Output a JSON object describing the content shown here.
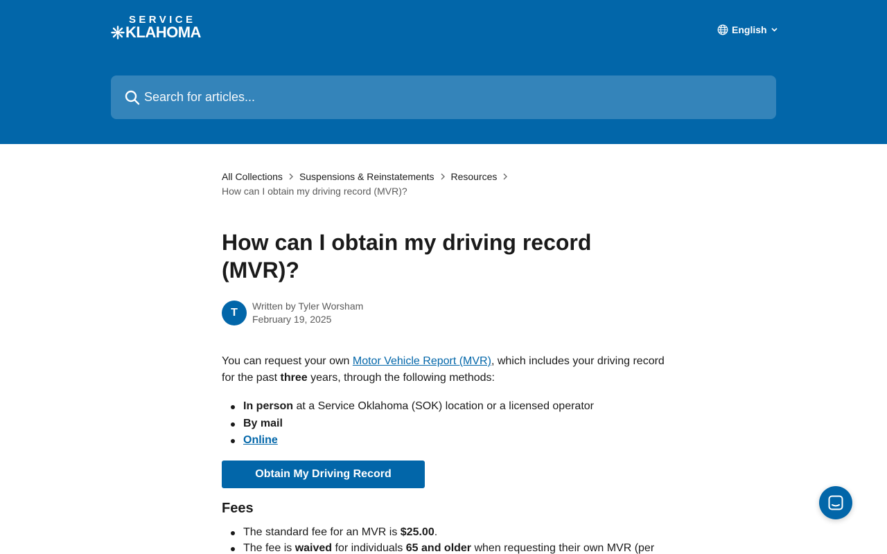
{
  "header": {
    "logo_top": "SERVICE",
    "logo_bottom": "KLAHOMA",
    "language": "English",
    "search_placeholder": "Search for articles...",
    "bg_color": "#0266a9"
  },
  "breadcrumb": {
    "items": [
      "All Collections",
      "Suspensions & Reinstatements",
      "Resources"
    ],
    "current": "How can I obtain my driving record (MVR)?"
  },
  "article": {
    "title": "How can I obtain my driving record (MVR)?",
    "author_initial": "T",
    "author_line": "Written by Tyler Worsham",
    "date": "February 19, 2025",
    "intro_1": "You can request your own ",
    "intro_link": "Motor Vehicle Report (MVR)",
    "intro_2": ", which includes your driving record for the past ",
    "intro_bold": "three",
    "intro_3": " years, through the following methods:",
    "methods": {
      "in_person_bold": "In person",
      "in_person_rest": " at a Service Oklahoma (SOK) location or a licensed operator",
      "by_mail": "By mail",
      "online": "Online"
    },
    "cta_label": "Obtain My Driving Record",
    "fees_heading": "Fees",
    "fees": {
      "fee1_text": "The standard fee for an MVR is ",
      "fee1_bold": "$25.00",
      "fee1_end": ".",
      "fee2_a": "The fee is ",
      "fee2_b": "waived",
      "fee2_c": " for individuals ",
      "fee2_d": "65 and older",
      "fee2_e": " when requesting their own MVR (per"
    }
  },
  "icons": {
    "globe": "globe-icon",
    "chevron": "chevron-down-icon",
    "search": "search-icon",
    "chat": "chat-icon"
  },
  "colors": {
    "accent": "#0266a9",
    "text": "#1a1a1a",
    "muted": "#5a5a5a"
  }
}
